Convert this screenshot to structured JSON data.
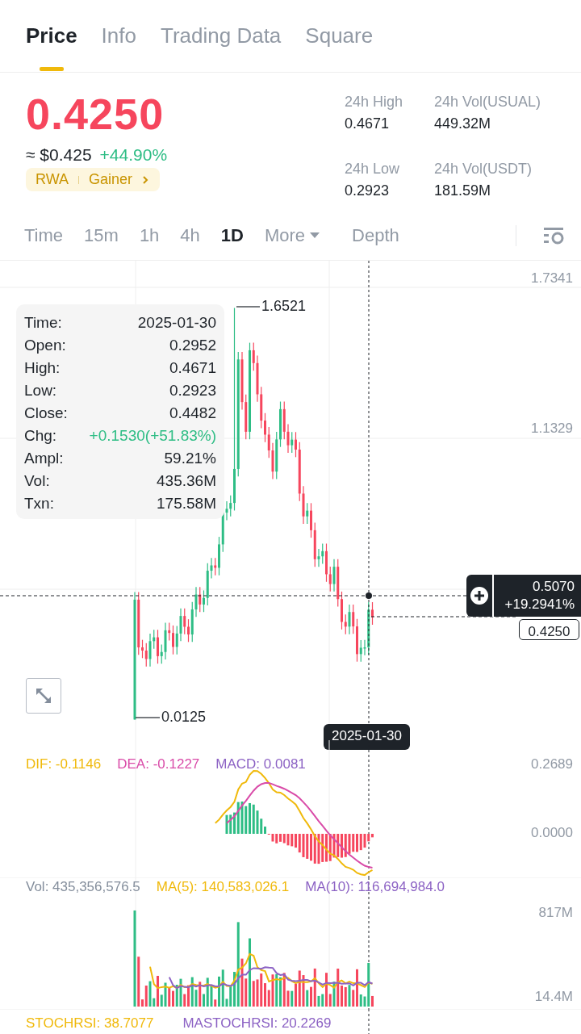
{
  "tabs": [
    {
      "label": "Price",
      "selected": true
    },
    {
      "label": "Info",
      "selected": false
    },
    {
      "label": "Trading Data",
      "selected": false
    },
    {
      "label": "Square",
      "selected": false
    }
  ],
  "price": {
    "value": "0.4250",
    "fiat": "≈ $0.425",
    "change": "+44.90%",
    "tags": [
      "RWA",
      "Gainer"
    ]
  },
  "stats": [
    {
      "label": "24h High",
      "value": "0.4671"
    },
    {
      "label": "24h Vol(USUAL)",
      "value": "449.32M"
    },
    {
      "label": "24h Low",
      "value": "0.2923"
    },
    {
      "label": "24h Vol(USDT)",
      "value": "181.59M"
    }
  ],
  "intervals": [
    {
      "label": "Time",
      "selected": false,
      "kind": "plain"
    },
    {
      "label": "15m",
      "selected": false,
      "kind": "plain"
    },
    {
      "label": "1h",
      "selected": false,
      "kind": "plain"
    },
    {
      "label": "4h",
      "selected": false,
      "kind": "plain"
    },
    {
      "label": "1D",
      "selected": true,
      "kind": "plain"
    },
    {
      "label": "More",
      "selected": false,
      "kind": "dropdown"
    },
    {
      "label": "Depth",
      "selected": false,
      "kind": "plain"
    }
  ],
  "chart": {
    "axis_labels": [
      "1.7341",
      "1.1329"
    ],
    "high_marker": "1.6521",
    "low_marker": "0.0125",
    "last_price": "0.4250",
    "crosshair": {
      "price": "0.5070",
      "change": "+19.2941%",
      "date": "2025-01-30"
    },
    "tooltip": [
      {
        "label": "Time:",
        "value": "2025-01-30",
        "kind": "plain"
      },
      {
        "label": "Open:",
        "value": "0.2952",
        "kind": "plain"
      },
      {
        "label": "High:",
        "value": "0.4671",
        "kind": "plain"
      },
      {
        "label": "Low:",
        "value": "0.2923",
        "kind": "plain"
      },
      {
        "label": "Close:",
        "value": "0.4482",
        "kind": "plain"
      },
      {
        "label": "Chg:",
        "value": "+0.1530(+51.83%)",
        "kind": "up"
      },
      {
        "label": "Ampl:",
        "value": "59.21%",
        "kind": "plain"
      },
      {
        "label": "Vol:",
        "value": "435.36M",
        "kind": "plain"
      },
      {
        "label": "Txn:",
        "value": "175.58M",
        "kind": "plain"
      }
    ]
  },
  "macd": {
    "legend": [
      {
        "text": "DIF: -0.1146",
        "color": "#f0b90b"
      },
      {
        "text": "DEA: -0.1227",
        "color": "#d94ba8"
      },
      {
        "text": "MACD: 0.0081",
        "color": "#8c62c4"
      }
    ],
    "axis_labels": [
      "0.2689",
      "0.0000"
    ]
  },
  "volume": {
    "legend": [
      {
        "text": "Vol: 435,356,576.5",
        "color": "#848e9c"
      },
      {
        "text": "MA(5): 140,583,026.1",
        "color": "#f0b90b"
      },
      {
        "text": "MA(10): 116,694,984.0",
        "color": "#8c62c4"
      }
    ],
    "axis_labels": [
      "817M",
      "14.4M"
    ]
  },
  "stochrsi": {
    "legend": [
      {
        "text": "STOCHRSI: 38.7077",
        "color": "#f0b90b"
      },
      {
        "text": "MASTOCHRSI: 20.2269",
        "color": "#8c62c4"
      }
    ]
  }
}
